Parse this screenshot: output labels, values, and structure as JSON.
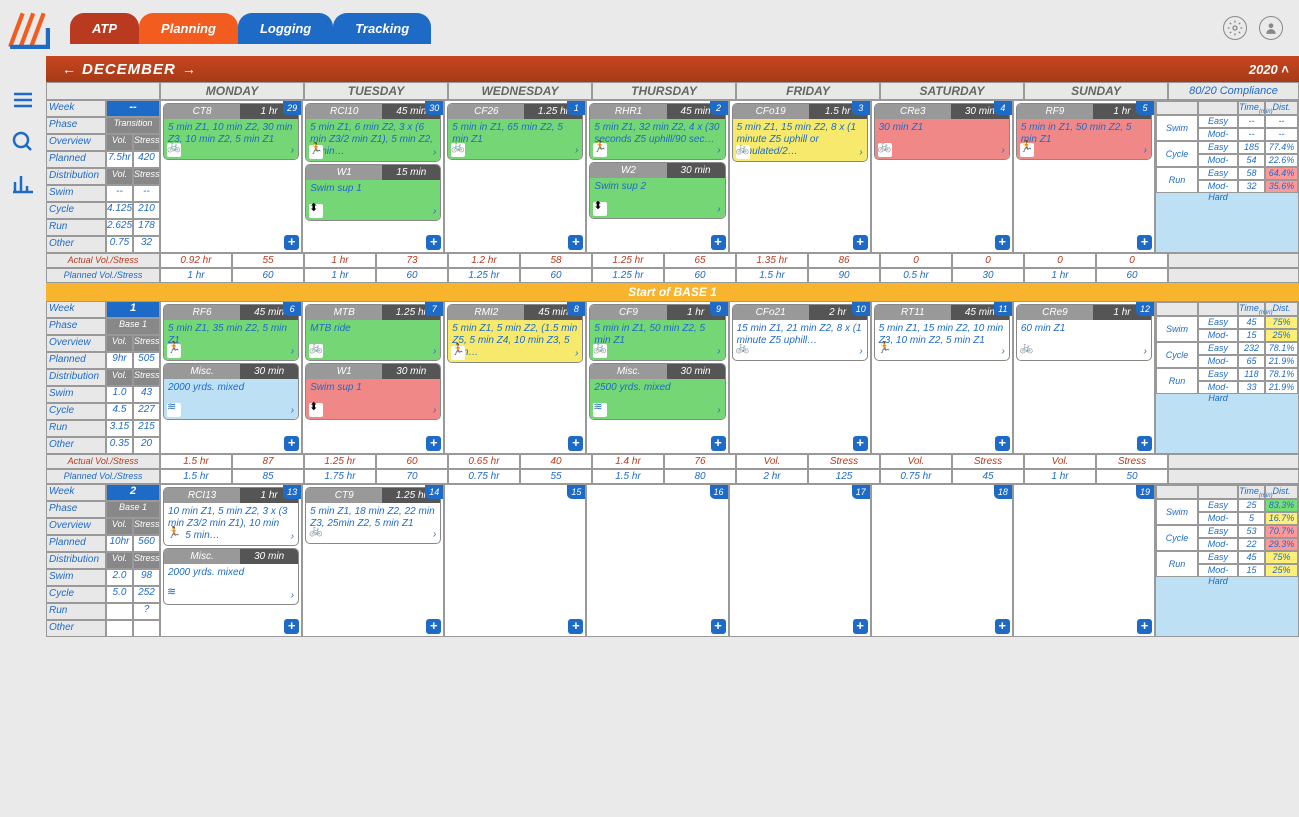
{
  "tabs": {
    "atp": "ATP",
    "planning": "Planning",
    "logging": "Logging",
    "tracking": "Tracking"
  },
  "month": "DECEMBER",
  "year": "2020",
  "days": [
    "MONDAY",
    "TUESDAY",
    "WEDNESDAY",
    "THURSDAY",
    "FRIDAY",
    "SATURDAY",
    "SUNDAY"
  ],
  "compliance_title": "80/20 Compliance",
  "comp_hdr": {
    "time": "Time",
    "dist": "Dist."
  },
  "levels": {
    "easy": "Easy",
    "hard": "Mod-Hard"
  },
  "sports": {
    "swim": "Swim",
    "cycle": "Cycle",
    "run": "Run"
  },
  "sidelabels": {
    "week": "Week",
    "phase": "Phase",
    "overview": "Overview",
    "planned": "Planned",
    "distribution": "Distribution",
    "swim": "Swim",
    "cycle": "Cycle",
    "run": "Run",
    "other": "Other",
    "vol": "Vol.",
    "stress": "Stress"
  },
  "stat": {
    "actual": "Actual Vol./Stress",
    "planned": "Planned Vol./Stress"
  },
  "phasebar": "Start of BASE 1",
  "weeks": [
    {
      "num": "--",
      "phase": "Transition",
      "planned_hr": "7.5hr",
      "planned_stress": "420",
      "swim": [
        "--",
        "--"
      ],
      "cycle": [
        "4.125",
        "210"
      ],
      "run": [
        "2.625",
        "178"
      ],
      "other": [
        "0.75",
        "32"
      ],
      "days": [
        {
          "n": "29",
          "cards": [
            {
              "name": "CT8",
              "dur": "1 hr",
              "body": "5 min Z1, 10 min Z2, 30 min Z3, 10 min Z2, 5 min Z1",
              "cls": "green",
              "ico": "bike"
            }
          ]
        },
        {
          "n": "30",
          "cards": [
            {
              "name": "RCI10",
              "dur": "45 min",
              "body": "5 min Z1, 6 min Z2, 3 x (6 min Z3/2 min Z1), 5 min Z2, 5 min…",
              "cls": "green",
              "ico": "run"
            },
            {
              "name": "W1",
              "dur": "15 min",
              "body": "Swim sup 1",
              "cls": "green",
              "ico": "str"
            }
          ]
        },
        {
          "n": "1",
          "cards": [
            {
              "name": "CF26",
              "dur": "1.25 hr",
              "body": "5 min in Z1, 65 min Z2, 5 min Z1",
              "cls": "green",
              "ico": "bike"
            }
          ]
        },
        {
          "n": "2",
          "cards": [
            {
              "name": "RHR1",
              "dur": "45 min",
              "body": "5 min Z1, 32 min Z2, 4 x (30 seconds Z5 uphill/90 sec…",
              "cls": "green",
              "ico": "run"
            },
            {
              "name": "W2",
              "dur": "30 min",
              "body": "Swim sup 2",
              "cls": "green",
              "ico": "str"
            }
          ]
        },
        {
          "n": "3",
          "cards": [
            {
              "name": "CFo19",
              "dur": "1.5 hr",
              "body": "5 min Z1, 15 min Z2, 8 x (1 minute Z5 uphill or simulated/2…",
              "cls": "yellow",
              "ico": "bike"
            }
          ]
        },
        {
          "n": "4",
          "cards": [
            {
              "name": "CRe3",
              "dur": "30 min",
              "body": "30 min Z1",
              "cls": "red",
              "ico": "bike"
            }
          ]
        },
        {
          "n": "5",
          "cards": [
            {
              "name": "RF9",
              "dur": "1 hr",
              "body": "5 min in Z1, 50 min Z2, 5 min Z1",
              "cls": "red",
              "ico": "run"
            }
          ]
        }
      ],
      "actual": [
        [
          "0.92 hr",
          "55"
        ],
        [
          "1 hr",
          "73"
        ],
        [
          "1.2 hr",
          "58"
        ],
        [
          "1.25 hr",
          "65"
        ],
        [
          "1.35 hr",
          "86"
        ],
        [
          "0",
          "0"
        ],
        [
          "0",
          "0"
        ]
      ],
      "plannedrow": [
        [
          "1 hr",
          "60"
        ],
        [
          "1 hr",
          "60"
        ],
        [
          "1.25 hr",
          "60"
        ],
        [
          "1.25 hr",
          "60"
        ],
        [
          "1.5 hr",
          "90"
        ],
        [
          "0.5 hr",
          "30"
        ],
        [
          "1 hr",
          "60"
        ]
      ],
      "comp": {
        "swim": [
          [
            "--",
            "--"
          ],
          [
            "--",
            "--"
          ]
        ],
        "cycle": [
          [
            "185",
            "77.4%",
            ""
          ],
          [
            "54",
            "22.6%",
            ""
          ]
        ],
        "run": [
          [
            "58",
            "64.4%",
            "r"
          ],
          [
            "32",
            "35.6%",
            "r"
          ]
        ]
      }
    },
    {
      "num": "1",
      "phase": "Base 1",
      "planned_hr": "9hr",
      "planned_stress": "505",
      "swim": [
        "1.0",
        "43"
      ],
      "cycle": [
        "4.5",
        "227"
      ],
      "run": [
        "3.15",
        "215"
      ],
      "other": [
        "0.35",
        "20"
      ],
      "days": [
        {
          "n": "6",
          "cards": [
            {
              "name": "RF6",
              "dur": "45 min",
              "body": "5 min Z1, 35 min Z2, 5 min Z1",
              "cls": "green",
              "ico": "run"
            },
            {
              "name": "Misc.",
              "dur": "30 min",
              "body": "2000 yrds. mixed",
              "cls": "blue",
              "ico": "swim"
            }
          ]
        },
        {
          "n": "7",
          "cards": [
            {
              "name": "MTB",
              "dur": "1.25 hr",
              "body": "MTB ride",
              "cls": "green",
              "ico": "bike"
            },
            {
              "name": "W1",
              "dur": "30 min",
              "body": "Swim sup 1",
              "cls": "red",
              "ico": "str"
            }
          ]
        },
        {
          "n": "8",
          "cards": [
            {
              "name": "RMI2",
              "dur": "45 min",
              "body": "5 min Z1, 5 min Z2, (1.5 min Z5, 5 min Z4, 10 min Z3, 5 min…",
              "cls": "yellow",
              "ico": "run"
            }
          ]
        },
        {
          "n": "9",
          "cards": [
            {
              "name": "CF9",
              "dur": "1 hr",
              "body": "5 min in Z1, 50 min Z2, 5 min Z1",
              "cls": "green",
              "ico": "bike"
            },
            {
              "name": "Misc.",
              "dur": "30 min",
              "body": "2500 yrds. mixed",
              "cls": "green",
              "ico": "swim"
            }
          ]
        },
        {
          "n": "10",
          "cards": [
            {
              "name": "CFo21",
              "dur": "2 hr",
              "body": "15 min Z1, 21 min Z2, 8 x (1 minute Z5 uphill…",
              "cls": "",
              "ico": "bike"
            }
          ]
        },
        {
          "n": "11",
          "cards": [
            {
              "name": "RT11",
              "dur": "45 min",
              "body": "5 min Z1, 15 min Z2, 10 min Z3, 10 min Z2, 5 min Z1",
              "cls": "",
              "ico": "run"
            }
          ]
        },
        {
          "n": "12",
          "cards": [
            {
              "name": "CRe9",
              "dur": "1 hr",
              "body": "60 min Z1",
              "cls": "",
              "ico": "bike"
            }
          ]
        }
      ],
      "actual": [
        [
          "1.5 hr",
          "87"
        ],
        [
          "1.25 hr",
          "60"
        ],
        [
          "0.65 hr",
          "40"
        ],
        [
          "1.4 hr",
          "76"
        ],
        [
          "Vol.",
          "Stress"
        ],
        [
          "Vol.",
          "Stress"
        ],
        [
          "Vol.",
          "Stress"
        ]
      ],
      "plannedrow": [
        [
          "1.5 hr",
          "85"
        ],
        [
          "1.75 hr",
          "70"
        ],
        [
          "0.75 hr",
          "55"
        ],
        [
          "1.5 hr",
          "80"
        ],
        [
          "2 hr",
          "125"
        ],
        [
          "0.75 hr",
          "45"
        ],
        [
          "1 hr",
          "50"
        ]
      ],
      "comp": {
        "swim": [
          [
            "45",
            "75%",
            "y"
          ],
          [
            "15",
            "25%",
            "y"
          ]
        ],
        "cycle": [
          [
            "232",
            "78.1%",
            ""
          ],
          [
            "65",
            "21.9%",
            ""
          ]
        ],
        "run": [
          [
            "118",
            "78.1%",
            ""
          ],
          [
            "33",
            "21.9%",
            ""
          ]
        ]
      }
    },
    {
      "num": "2",
      "phase": "Base 1",
      "planned_hr": "10hr",
      "planned_stress": "560",
      "swim": [
        "2.0",
        "98"
      ],
      "cycle": [
        "5.0",
        "252"
      ],
      "run": [
        "",
        "?"
      ],
      "other": [
        "",
        ""
      ],
      "days": [
        {
          "n": "13",
          "cards": [
            {
              "name": "RCI13",
              "dur": "1 hr",
              "body": "10 min Z1, 5 min Z2, 3 x (3 min Z3/2 min Z1), 10 min Z2, 5 min…",
              "cls": "",
              "ico": "run"
            },
            {
              "name": "Misc.",
              "dur": "30 min",
              "body": "2000 yrds. mixed",
              "cls": "",
              "ico": "swim"
            }
          ]
        },
        {
          "n": "14",
          "cards": [
            {
              "name": "CT9",
              "dur": "1.25 hr",
              "body": "5 min Z1, 18 min Z2, 22 min Z3, 25min Z2, 5 min Z1",
              "cls": "",
              "ico": "bike"
            }
          ]
        },
        {
          "n": "15",
          "cards": []
        },
        {
          "n": "16",
          "cards": []
        },
        {
          "n": "17",
          "cards": []
        },
        {
          "n": "18",
          "cards": []
        },
        {
          "n": "19",
          "cards": []
        }
      ],
      "actual": [],
      "plannedrow": [],
      "comp": {
        "swim": [
          [
            "25",
            "83.3%",
            "g"
          ],
          [
            "5",
            "16.7%",
            "y"
          ]
        ],
        "cycle": [
          [
            "53",
            "70.7%",
            "r"
          ],
          [
            "22",
            "29.3%",
            "r"
          ]
        ],
        "run": [
          [
            "45",
            "75%",
            "y"
          ],
          [
            "15",
            "25%",
            "y"
          ]
        ]
      }
    }
  ]
}
